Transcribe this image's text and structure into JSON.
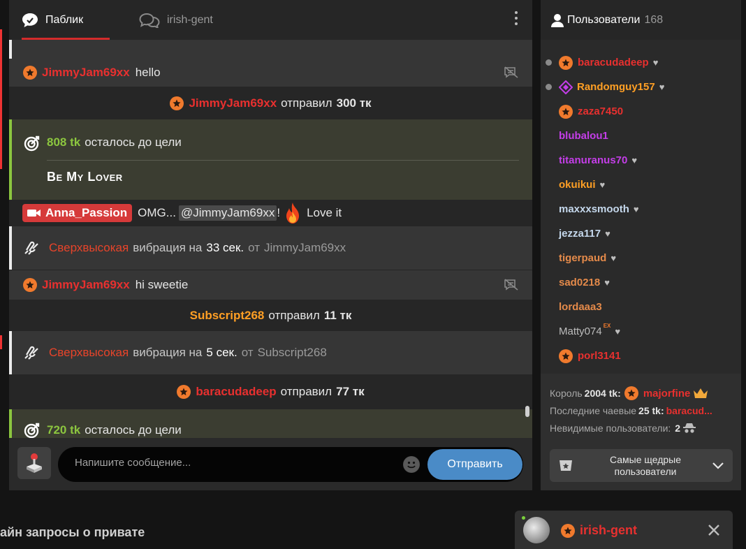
{
  "chat": {
    "tabs": [
      {
        "label": "Паблик"
      },
      {
        "label": "irish-gent"
      }
    ],
    "messages": [
      {
        "user": "JimmyJam69xx",
        "text": "hello"
      },
      {
        "user": "JimmyJam69xx",
        "sent": "отправил",
        "amount": "300 тк"
      },
      {
        "goal_amount": "808 tk",
        "goal_text": "осталось до цели",
        "goal_title": "Be My Lover"
      },
      {
        "user": "Anna_Passion",
        "text_before": "OMG...",
        "mention": "@JimmyJam69xx",
        "text_after": "!",
        "text_end": "Love it"
      },
      {
        "vib_level": "Сверхвысокая",
        "vib_mid": "вибрация на",
        "vib_time": "33 сек.",
        "vib_from": "от",
        "vib_user": "JimmyJam69xx"
      },
      {
        "user": "JimmyJam69xx",
        "text": "hi sweetie"
      },
      {
        "user": "Subscript268",
        "sent": "отправил",
        "amount": "11 тк"
      },
      {
        "vib_level": "Сверхвысокая",
        "vib_mid": "вибрация на",
        "vib_time": "5 сек.",
        "vib_from": "от",
        "vib_user": "Subscript268"
      },
      {
        "user": "baracudadeep",
        "sent": "отправил",
        "amount": "77 тк"
      },
      {
        "goal_amount": "720 tk",
        "goal_text": "осталось до цели"
      }
    ],
    "input_placeholder": "Напишите сообщение...",
    "send_label": "Отправить"
  },
  "users": {
    "title": "Пользователи",
    "count": "168",
    "list": [
      {
        "name": "baracudadeep",
        "color": "#e8302f"
      },
      {
        "name": "Randomguy157",
        "color": "#ff9f24"
      },
      {
        "name": "zaza7450",
        "color": "#e8302f"
      },
      {
        "name": "blubalou1",
        "color": "#c43ee8"
      },
      {
        "name": "titanuranus70",
        "color": "#c43ee8"
      },
      {
        "name": "okuikui",
        "color": "#ff9f24"
      },
      {
        "name": "maxxxsmooth",
        "color": "#c5d8ec"
      },
      {
        "name": "jezza117",
        "color": "#c5d8ec"
      },
      {
        "name": "tigerpaud",
        "color": "#e48a4a"
      },
      {
        "name": "sad0218",
        "color": "#e48a4a"
      },
      {
        "name": "lordaaa3",
        "color": "#e48a4a"
      },
      {
        "name": "Matty074",
        "badge": "EX",
        "color": "#bdbdbd"
      },
      {
        "name": "porl3141",
        "color": "#e8302f"
      }
    ],
    "king_label": "Король",
    "king_amount": "2004 tk:",
    "king_name": "majorfine",
    "last_tip_label": "Последние чаевые",
    "last_tip_amount": "25 tk:",
    "last_tip_name": "baracud...",
    "invisible_label": "Невидимые пользователи:",
    "invisible_count": "2",
    "generous_line1": "Самые щедрые",
    "generous_line2": "пользователи"
  },
  "private_requests": "айн запросы о привате",
  "dm": {
    "name": "irish-gent"
  }
}
